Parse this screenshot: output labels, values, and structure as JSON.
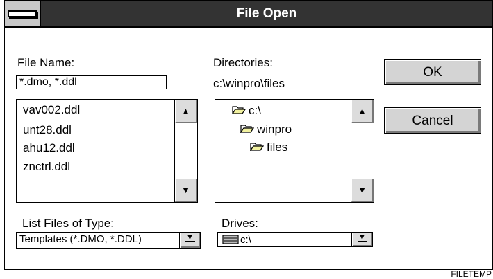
{
  "window": {
    "title": "File Open"
  },
  "file_name": {
    "label": "File Name:",
    "value": "*.dmo, *.ddl",
    "files": [
      "vav002.ddl",
      "unt28.ddl",
      "ahu12.ddl",
      "znctrl.ddl"
    ]
  },
  "directories": {
    "label": "Directories:",
    "current_path": "c:\\winpro\\files",
    "tree": [
      "c:\\",
      "winpro",
      "files"
    ]
  },
  "buttons": {
    "ok": "OK",
    "cancel": "Cancel"
  },
  "file_type": {
    "label": "List Files of Type:",
    "selected": "Templates (*.DMO, *.DDL)"
  },
  "drives": {
    "label": "Drives:",
    "selected": "c:\\"
  },
  "scroll_icons": {
    "up": "up-arrow-icon",
    "down": "down-arrow-icon"
  },
  "footer": {
    "code": "FILETEMP"
  },
  "colors": {
    "titlebar": "#333333",
    "button_face": "#d4d4d4",
    "folder": "#f2f2a0"
  }
}
